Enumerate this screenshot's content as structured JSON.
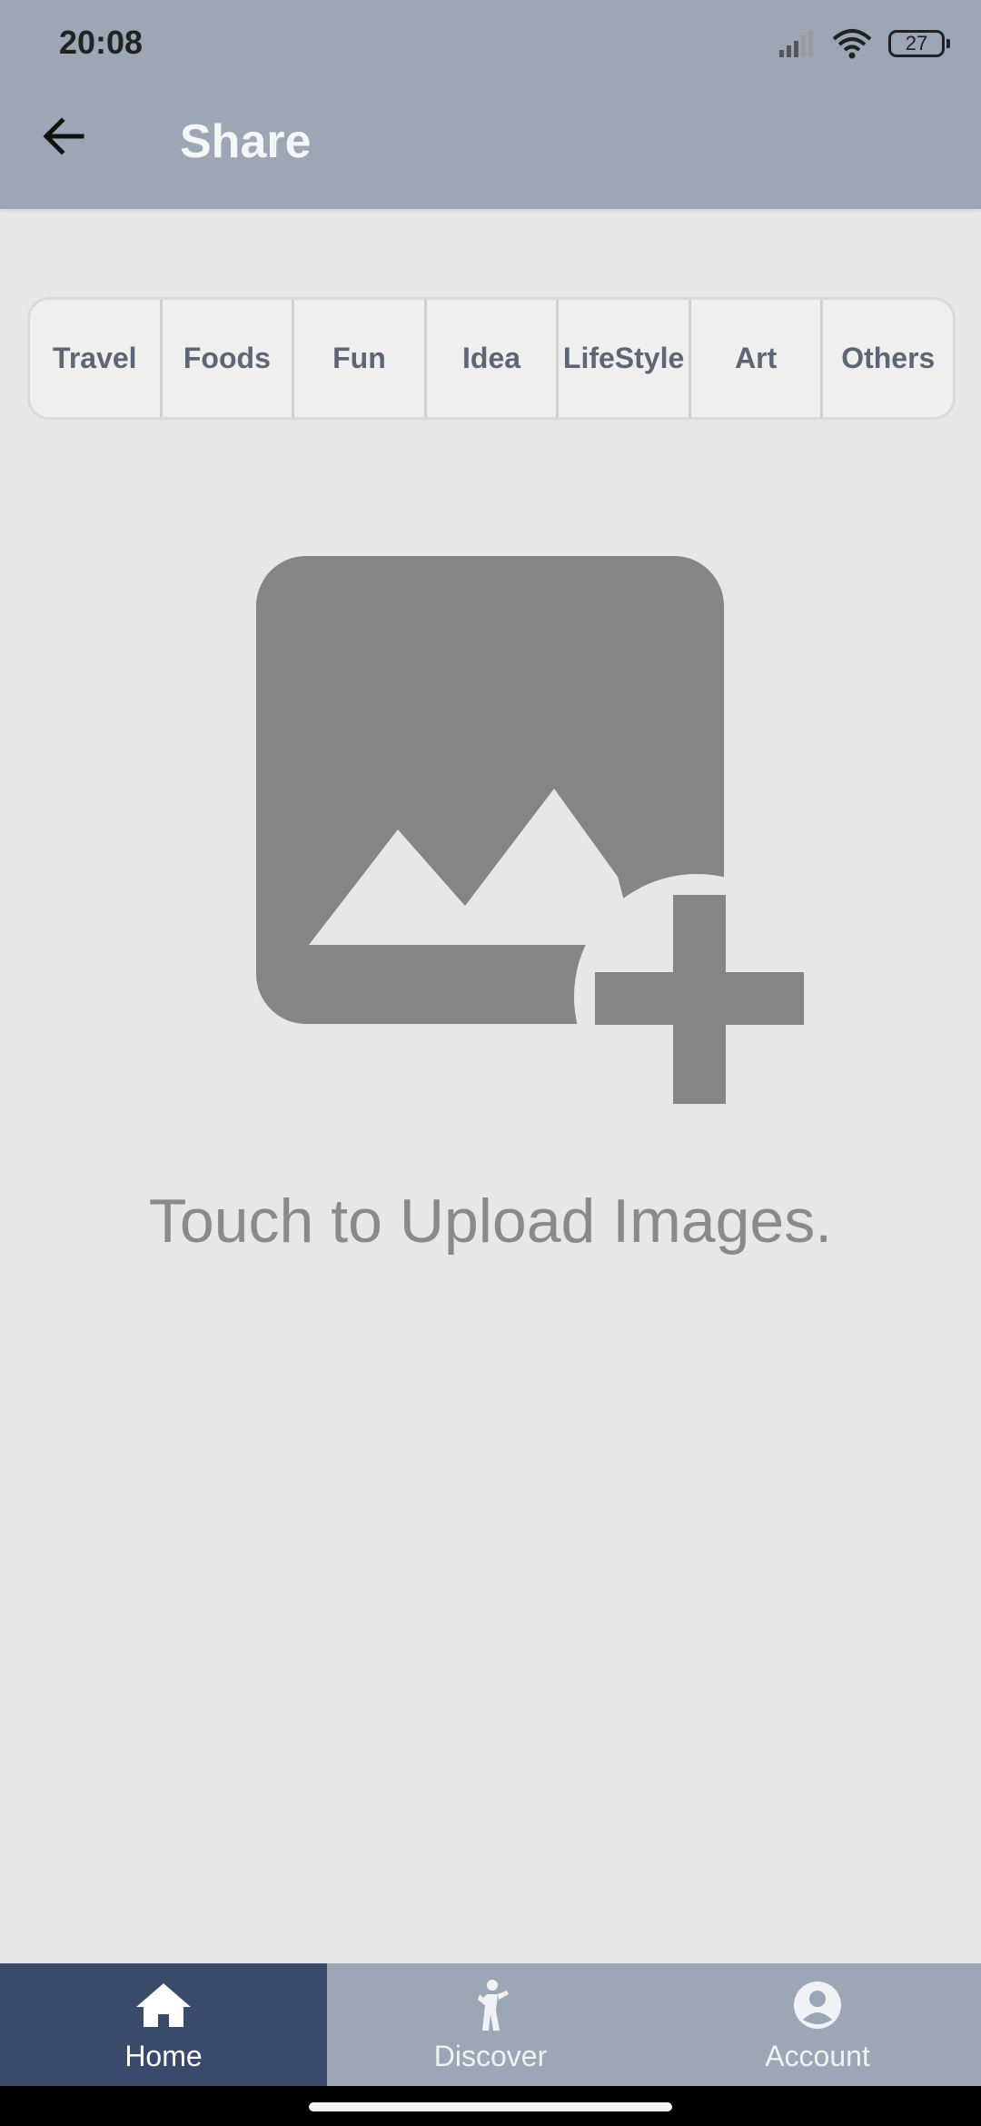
{
  "status_bar": {
    "time": "20:08",
    "battery": "27"
  },
  "header": {
    "title": "Share",
    "back_icon": "arrow-left-icon"
  },
  "categories": [
    {
      "label": "Travel"
    },
    {
      "label": "Foods"
    },
    {
      "label": "Fun"
    },
    {
      "label": "Idea"
    },
    {
      "label": "LifeStyle"
    },
    {
      "label": "Art"
    },
    {
      "label": "Others"
    }
  ],
  "upload": {
    "icon": "add-photo-icon",
    "text": "Touch to Upload Images."
  },
  "bottom_nav": {
    "items": [
      {
        "label": "Home",
        "icon": "home-icon",
        "active": true
      },
      {
        "label": "Discover",
        "icon": "walking-person-icon",
        "active": false
      },
      {
        "label": "Account",
        "icon": "account-circle-icon",
        "active": false
      }
    ]
  },
  "colors": {
    "header_bg": "#9ca6b5",
    "active_nav_bg": "#3a4a6a",
    "page_bg": "#e7e7e7",
    "icon_gray": "#858585"
  }
}
